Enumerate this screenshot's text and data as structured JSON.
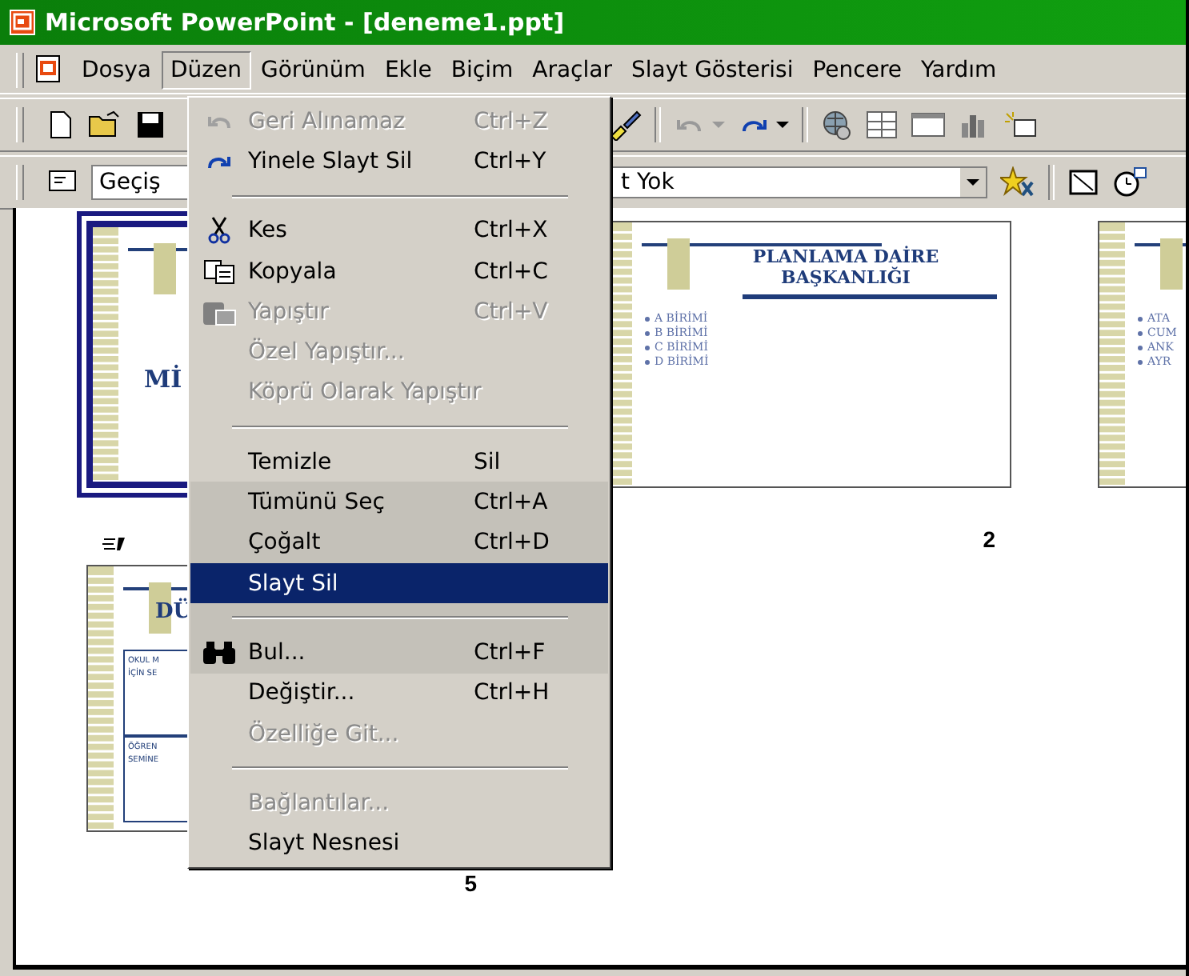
{
  "window": {
    "title": "Microsoft PowerPoint - [deneme1.ppt]"
  },
  "menu_bar": [
    {
      "label": "Dosya",
      "selected": false
    },
    {
      "label": "Düzen",
      "selected": true
    },
    {
      "label": "Görünüm",
      "selected": false
    },
    {
      "label": "Ekle",
      "selected": false
    },
    {
      "label": "Biçim",
      "selected": false
    },
    {
      "label": "Araçlar",
      "selected": false
    },
    {
      "label": "Slayt Gösterisi",
      "selected": false
    },
    {
      "label": "Pencere",
      "selected": false
    },
    {
      "label": "Yardım",
      "selected": false
    }
  ],
  "formatting_toolbar": {
    "transition_field": "Geçiş",
    "effect_field": "t Yok"
  },
  "slides": [
    {
      "kind": "title",
      "selected": true,
      "title": "Mİ",
      "transition": true
    },
    {
      "kind": "bullets",
      "selected": false,
      "title": "PLANLAMA DAİRE BAŞKANLIĞI",
      "bullets": [
        "A BİRİMİ",
        "B BİRİMİ",
        "C BİRİMİ",
        "D BİRİMİ"
      ],
      "number": "2"
    },
    {
      "kind": "bullets",
      "selected": false,
      "bullets": [
        "ATA",
        "CUM",
        "ANK",
        "AYR"
      ]
    },
    {
      "kind": "boxes",
      "selected": false,
      "title": "DÜ",
      "boxes": [
        {
          "lines": [
            "OKUL M",
            "İÇİN SE"
          ]
        },
        {
          "lines": [
            "ÖĞREN",
            "SEMİNE"
          ]
        }
      ],
      "number": "5"
    }
  ],
  "edit_menu": [
    {
      "kind": "item",
      "label": "Geri Alınamaz",
      "shortcut": "Ctrl+Z",
      "disabled": true,
      "selected": false,
      "recessed": false
    },
    {
      "kind": "item",
      "label": "Yinele Slayt Sil",
      "shortcut": "Ctrl+Y",
      "disabled": false,
      "selected": false,
      "recessed": false
    },
    {
      "kind": "separator"
    },
    {
      "kind": "item",
      "label": "Kes",
      "shortcut": "Ctrl+X",
      "disabled": false,
      "selected": false,
      "recessed": false
    },
    {
      "kind": "item",
      "label": "Kopyala",
      "shortcut": "Ctrl+C",
      "disabled": false,
      "selected": false,
      "recessed": false
    },
    {
      "kind": "item",
      "label": "Yapıştır",
      "shortcut": "Ctrl+V",
      "disabled": true,
      "selected": false,
      "recessed": false
    },
    {
      "kind": "item",
      "label": "Özel Yapıştır...",
      "disabled": true,
      "selected": false,
      "recessed": false
    },
    {
      "kind": "item",
      "label": "Köprü Olarak Yapıştır",
      "disabled": true,
      "selected": false,
      "recessed": false
    },
    {
      "kind": "separator"
    },
    {
      "kind": "item",
      "label": "Temizle",
      "shortcut": "Sil",
      "disabled": false,
      "selected": false,
      "recessed": false
    },
    {
      "kind": "item",
      "label": "Tümünü Seç",
      "shortcut": "Ctrl+A",
      "disabled": false,
      "selected": false,
      "recessed": true
    },
    {
      "kind": "item",
      "label": "Çoğalt",
      "shortcut": "Ctrl+D",
      "disabled": false,
      "selected": false,
      "recessed": true
    },
    {
      "kind": "item",
      "label": "Slayt Sil",
      "disabled": false,
      "selected": true,
      "recessed": true
    },
    {
      "kind": "separator"
    },
    {
      "kind": "item",
      "label": "Bul...",
      "shortcut": "Ctrl+F",
      "disabled": false,
      "selected": false,
      "recessed": true
    },
    {
      "kind": "item",
      "label": "Değiştir...",
      "shortcut": "Ctrl+H",
      "disabled": false,
      "selected": false,
      "recessed": false
    },
    {
      "kind": "item",
      "label": "Özelliğe Git...",
      "disabled": true,
      "selected": false,
      "recessed": false
    },
    {
      "kind": "separator"
    },
    {
      "kind": "item",
      "label": "Bağlantılar...",
      "disabled": true,
      "selected": false,
      "recessed": false
    },
    {
      "kind": "item",
      "label": "Slayt Nesnesi",
      "disabled": false,
      "selected": false,
      "recessed": false
    }
  ]
}
